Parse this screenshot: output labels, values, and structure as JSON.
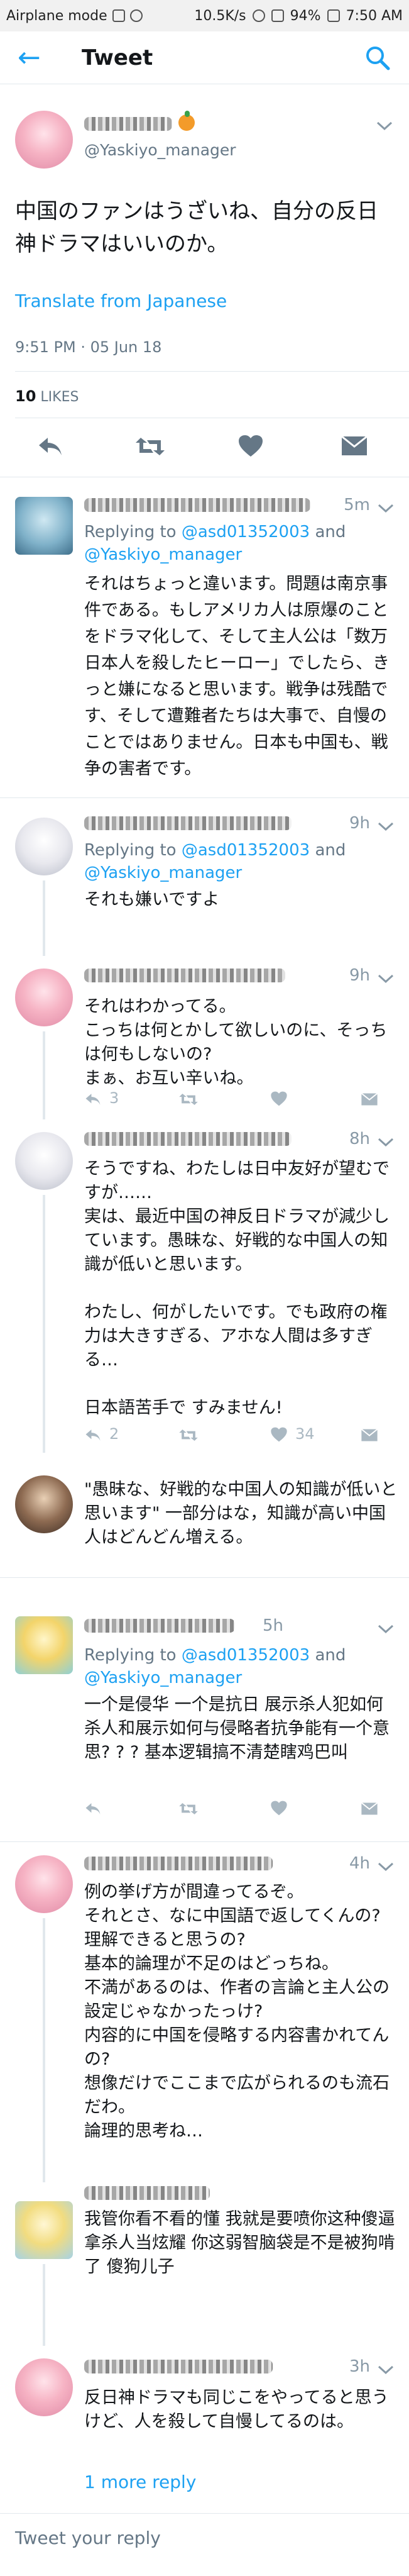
{
  "status_bar": {
    "left": "Airplane mode",
    "speed": "10.5K/s",
    "battery": "94%",
    "time": "7:50 AM"
  },
  "app_bar": {
    "title": "Tweet"
  },
  "main_tweet": {
    "handle": "@Yaskiyo_manager",
    "text": "中国のファンはうざいね、自分の反日神ドラマはいいのか。",
    "translate": "Translate from Japanese",
    "timestamp": "9:51 PM · 05 Jun 18",
    "likes_count": "10",
    "likes_label": "LIKES"
  },
  "replies": [
    {
      "time": "5m",
      "replying_prefix": "Replying to",
      "mention_1": "@asd01352003",
      "and": "and",
      "mention_2": "@Yaskiyo_manager",
      "text": "それはちょっと違います。問題は南京事件である。もしアメリカ人は原爆のことをドラマ化して、そして主人公は「数万日本人を殺したヒーロー」でしたら、きっと嫌になると思います。戦争は残酷です、そして遭難者たちは大事で、自慢のことではありません。日本も中国も、戦争の害者です。"
    },
    {
      "time": "9h",
      "replying_prefix": "Replying to",
      "mention_1": "@asd01352003",
      "and": "and",
      "mention_2": "@Yaskiyo_manager",
      "text": "それも嫌いですよ"
    },
    {
      "time": "9h",
      "text": "それはわかってる。\nこっちは何とかして欲しいのに、そっちは何もしないの?\nまぁ、お互い辛いね。",
      "reply_count": "3"
    },
    {
      "time": "8h",
      "text": "そうですね、わたしは日中友好が望むですが……\n実は、最近中国の神反日ドラマが減少しています。愚昧な、好戦的な中国人の知識が低いと思います。\n\nわたし、何がしたいです。でも政府の権力は大きすぎる、アホな人間は多すぎる…\n\n日本語苦手で すみません!",
      "reply_count": "2",
      "like_count": "34"
    },
    {
      "text": "\"愚昧な、好戦的な中国人の知識が低いと思います\" 一部分はな，知識が高い中国人はどんどん増える。"
    },
    {
      "time": "5h",
      "replying_prefix": "Replying to",
      "mention_1": "@asd01352003",
      "and": "and",
      "mention_2": "@Yaskiyo_manager",
      "text": "一个是侵华 一个是抗日 展示杀人犯如何杀人和展示如何与侵略者抗争能有一个意思? ? ?  基本逻辑搞不清楚瞎鸡巴叫"
    },
    {
      "time": "4h",
      "text": "例の挙げ方が間違ってるぞ。\nそれとさ、なに中国語で返してくんの?\n理解できると思うの?\n基本的論理が不足のはどっちね。\n不満があるのは、作者の言論と主人公の設定じゃなかったっけ?\n内容的に中国を侵略する内容書かれてんの?\n想像だけでここまで広がられるのも流石だわ。\n論理的思考ね…"
    },
    {
      "text": "我管你看不看的懂 我就是要喷你这种傻逼 拿杀人当炫耀 你这弱智脑袋是不是被狗啃了 傻狗儿子"
    },
    {
      "time": "3h",
      "text": "反日神ドラマも同じこをやってると思うけど、人を殺して自慢してるのは。"
    }
  ],
  "more_reply": "1 more reply",
  "compose_placeholder": "Tweet your reply",
  "colors": {
    "accent": "#1da1f2",
    "muted": "#657786",
    "icon": "#aab8c2"
  },
  "icons": [
    "back-arrow-icon",
    "search-icon",
    "reply-icon",
    "retweet-icon",
    "heart-icon",
    "message-icon",
    "chevron-down-icon"
  ]
}
